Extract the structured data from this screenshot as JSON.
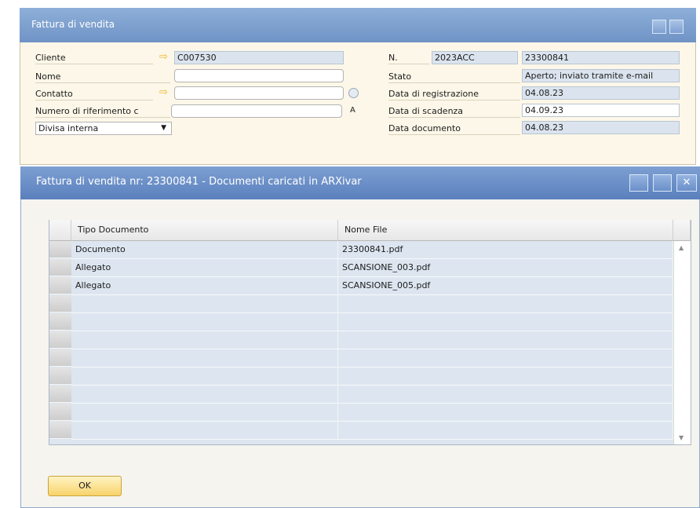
{
  "back_window": {
    "title": "Fattura di vendita",
    "left_labels": [
      "Cliente",
      "Nome",
      "Contatto",
      "Numero di riferimento c"
    ],
    "cliente_value": "C007530",
    "riferimento_suffix": "A",
    "currency_select": "Divisa interna",
    "right_labels": [
      "N.",
      "Stato",
      "Data di registrazione",
      "Data di scadenza",
      "Data documento"
    ],
    "series": "2023ACC",
    "number": "23300841",
    "stato": "Aperto; inviato tramite e-mail",
    "data_registrazione": "04.08.23",
    "data_scadenza": "04.09.23",
    "data_documento": "04.08.23"
  },
  "dialog": {
    "title": "Fattura di vendita nr: 23300841 - Documenti caricati in ARXivar",
    "columns": [
      "Tipo Documento",
      "Nome File"
    ],
    "rows": [
      {
        "tipo": "Documento",
        "file": "23300841.pdf"
      },
      {
        "tipo": "Allegato",
        "file": "SCANSIONE_003.pdf"
      },
      {
        "tipo": "Allegato",
        "file": "SCANSIONE_005.pdf"
      }
    ],
    "ok_label": "OK"
  }
}
